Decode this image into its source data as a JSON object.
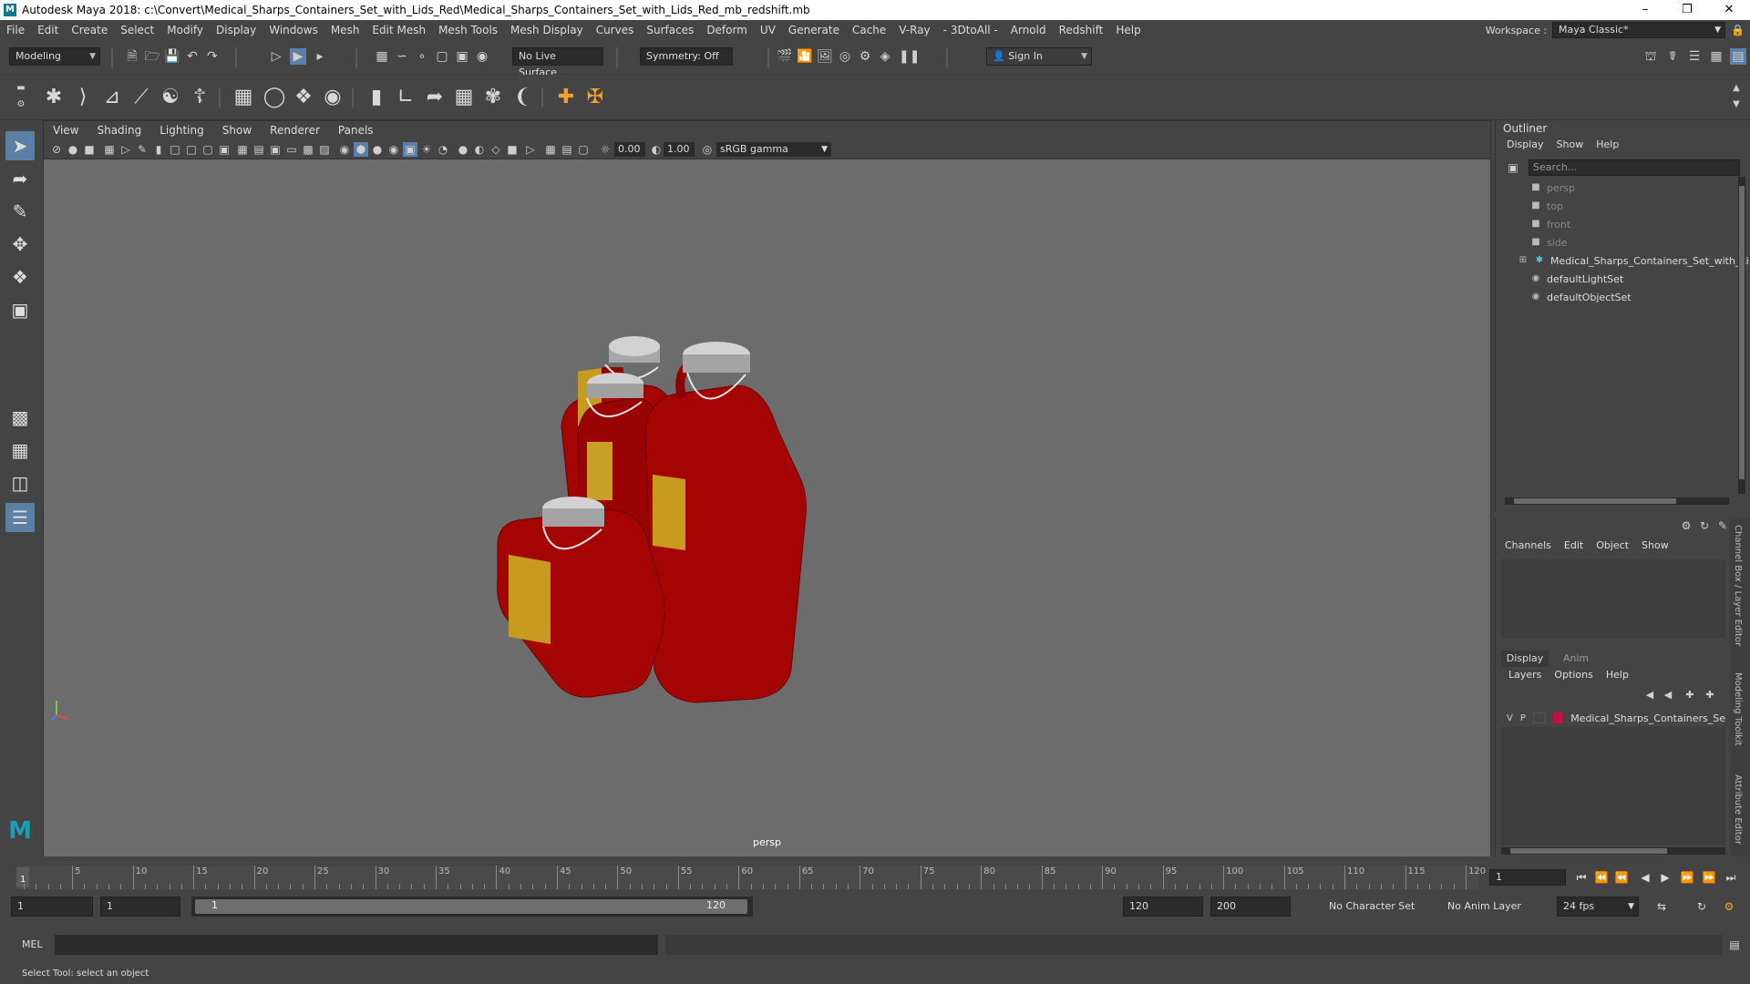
{
  "titlebar": {
    "title": "Autodesk Maya 2018: c:\\Convert\\Medical_Sharps_Containers_Set_with_Lids_Red\\Medical_Sharps_Containers_Set_with_Lids_Red_mb_redshift.mb",
    "app_icon": "M"
  },
  "menubar": {
    "items": [
      "File",
      "Edit",
      "Create",
      "Select",
      "Modify",
      "Display",
      "Windows",
      "Mesh",
      "Edit Mesh",
      "Mesh Tools",
      "Mesh Display",
      "Curves",
      "Surfaces",
      "Deform",
      "UV",
      "Generate",
      "Cache",
      "V-Ray",
      "- 3DtoAll -",
      "Arnold",
      "Redshift",
      "Help"
    ],
    "workspace_label": "Workspace :",
    "workspace_value": "Maya Classic*"
  },
  "statusline": {
    "mode": "Modeling",
    "live_surface": "No Live Surface",
    "symmetry": "Symmetry: Off",
    "sign_in": "Sign In"
  },
  "viewport": {
    "menu": [
      "View",
      "Shading",
      "Lighting",
      "Show",
      "Renderer",
      "Panels"
    ],
    "near_value": "0.00",
    "far_value": "1.00",
    "color_space": "sRGB gamma",
    "camera": "persp",
    "model_color": "#a50404",
    "lid_color": "#c8c8c8"
  },
  "outliner": {
    "title": "Outliner",
    "menu": [
      "Display",
      "Show",
      "Help"
    ],
    "search_placeholder": "Search...",
    "items": [
      {
        "label": "persp",
        "dim": true
      },
      {
        "label": "top",
        "dim": true
      },
      {
        "label": "front",
        "dim": true
      },
      {
        "label": "side",
        "dim": true
      },
      {
        "label": "Medical_Sharps_Containers_Set_with_Li",
        "dim": false
      },
      {
        "label": "defaultLightSet",
        "dim": false
      },
      {
        "label": "defaultObjectSet",
        "dim": false
      }
    ]
  },
  "channelbox": {
    "menu": [
      "Channels",
      "Edit",
      "Object",
      "Show"
    ]
  },
  "layereditor": {
    "tabs": [
      "Display",
      "Anim"
    ],
    "menu": [
      "Layers",
      "Options",
      "Help"
    ],
    "layer": {
      "v": "V",
      "p": "P",
      "name": "Medical_Sharps_Containers_Se",
      "color": "#c0143c"
    }
  },
  "sidetabs": [
    "Channel Box / Layer Editor",
    "Modeling Toolkit",
    "Attribute Editor"
  ],
  "timeline": {
    "ticks": [
      5,
      10,
      15,
      20,
      25,
      30,
      35,
      40,
      45,
      50,
      55,
      60,
      65,
      70,
      75,
      80,
      85,
      90,
      95,
      100,
      105,
      110,
      115,
      120
    ],
    "current_frame_marker": "1",
    "current_frame": "1"
  },
  "range": {
    "start": "1",
    "playback_start": "1",
    "slider_start": "1",
    "slider_end": "120",
    "playback_end": "120",
    "end": "200",
    "character_set": "No Character Set",
    "anim_layer": "No Anim Layer",
    "fps": "24 fps"
  },
  "cmdline": {
    "label": "MEL"
  },
  "helpline": {
    "text": "Select Tool: select an object"
  }
}
